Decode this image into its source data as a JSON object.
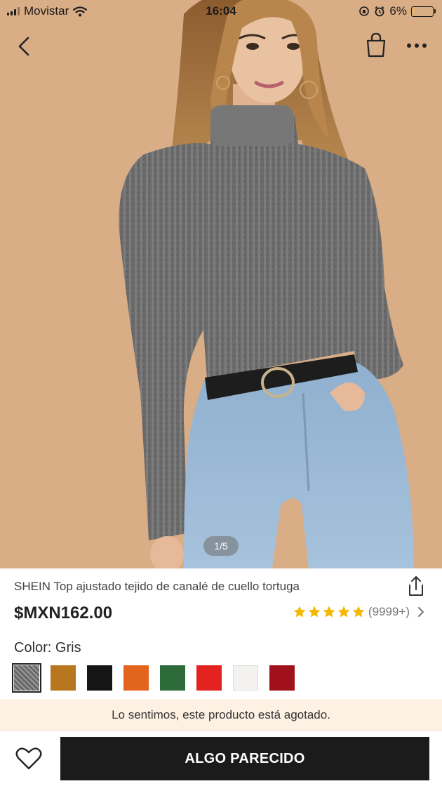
{
  "status_bar": {
    "carrier": "Movistar",
    "time": "16:04",
    "battery": "6%",
    "battery_level": 0.06,
    "battery_color": "#f4c20d"
  },
  "nav": {
    "back_icon": "chevron-left-icon",
    "bag_icon": "shopping-bag-icon",
    "more_icon": "more-horizontal-icon"
  },
  "gallery": {
    "indicator": "1/5",
    "current": 1,
    "total": 5
  },
  "product": {
    "title": "SHEIN Top ajustado tejido de canalé de cuello tortuga",
    "price": "$MXN162.00",
    "rating_stars": 5,
    "rating_count": "(9999+)",
    "star_color": "#f5b800",
    "share_icon": "share-icon"
  },
  "colors": {
    "label": "Color: Gris",
    "swatches": [
      {
        "name": "Gris",
        "color": "#7d7d7d",
        "selected": true
      },
      {
        "name": "Camel",
        "color": "#b8761f",
        "selected": false
      },
      {
        "name": "Negro",
        "color": "#151515",
        "selected": false
      },
      {
        "name": "Naranja",
        "color": "#e3641c",
        "selected": false
      },
      {
        "name": "Verde",
        "color": "#2e6b3a",
        "selected": false
      },
      {
        "name": "Rojo",
        "color": "#e2231f",
        "selected": false
      },
      {
        "name": "Blanco",
        "color": "#f4f2ee",
        "selected": false
      },
      {
        "name": "Vino",
        "color": "#a1111c",
        "selected": false
      }
    ]
  },
  "notice": {
    "text": "Lo sentimos, este producto está agotado.",
    "background": "#fdf1e3"
  },
  "actions": {
    "wishlist_icon": "heart-icon",
    "cta_label": "ALGO PARECIDO",
    "cta_color": "#1b1b1b"
  }
}
